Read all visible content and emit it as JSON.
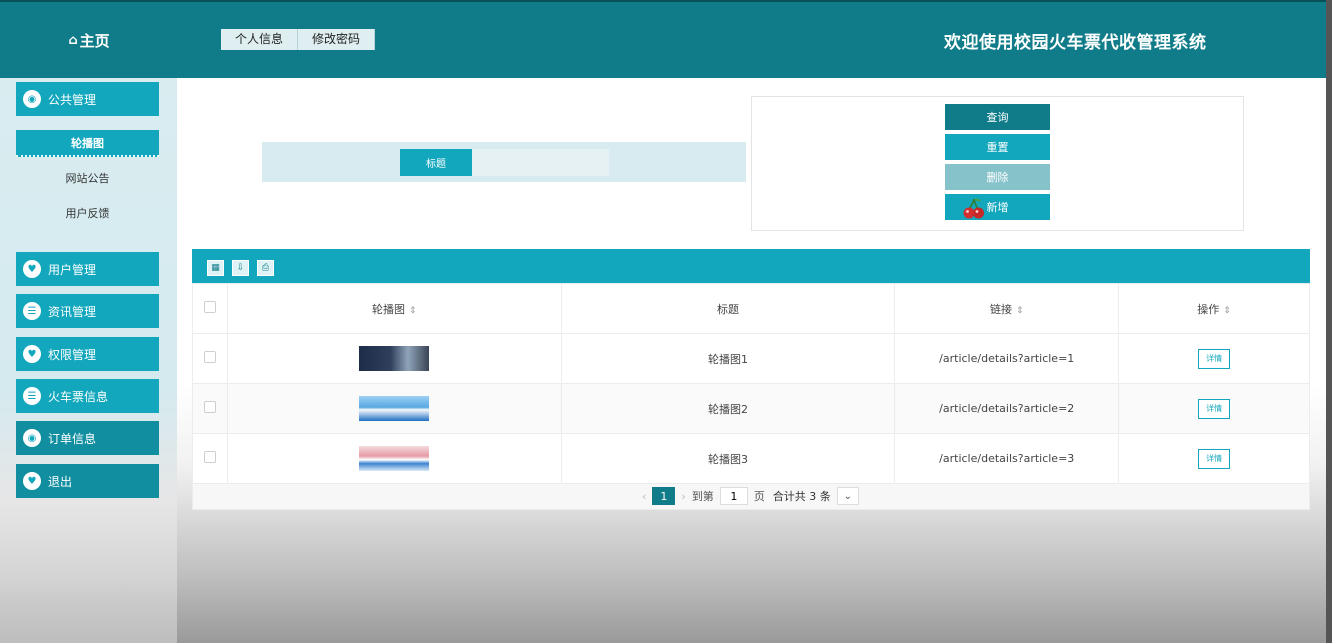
{
  "header": {
    "home_label": "主页",
    "home_icon": "home-icon",
    "tabs": [
      {
        "label": "个人信息"
      },
      {
        "label": "修改密码"
      }
    ],
    "title": "欢迎使用校园火车票代收管理系统"
  },
  "sidebar": {
    "menus": [
      {
        "label": "公共管理",
        "icon": "chat-icon"
      },
      {
        "label": "用户管理",
        "icon": "heart-icon"
      },
      {
        "label": "资讯管理",
        "icon": "list-icon"
      },
      {
        "label": "权限管理",
        "icon": "heart-icon"
      },
      {
        "label": "火车票信息",
        "icon": "list-icon"
      },
      {
        "label": "订单信息",
        "icon": "chat-icon"
      },
      {
        "label": "退出",
        "icon": "heart-icon"
      }
    ],
    "sub_items": [
      {
        "label": "轮播图",
        "active": true
      },
      {
        "label": "网站公告",
        "active": false
      },
      {
        "label": "用户反馈",
        "active": false
      }
    ]
  },
  "search": {
    "label": "标题",
    "value": "",
    "placeholder": ""
  },
  "buttons": {
    "query": "查询",
    "reset": "重置",
    "delete": "删除",
    "add": "新增"
  },
  "table": {
    "toolbar_icons": [
      "grid-icon",
      "export-icon",
      "print-icon"
    ],
    "columns": [
      "轮播图",
      "标题",
      "链接",
      "操作"
    ],
    "rows": [
      {
        "image": "banner-1",
        "title": "轮播图1",
        "link": "/article/details?article=1",
        "action": "详情"
      },
      {
        "image": "banner-2",
        "title": "轮播图2",
        "link": "/article/details?article=2",
        "action": "详情"
      },
      {
        "image": "banner-3",
        "title": "轮播图3",
        "link": "/article/details?article=3",
        "action": "详情"
      }
    ]
  },
  "pagination": {
    "current_page": "1",
    "goto_prefix": "到第",
    "goto_value": "1",
    "goto_suffix": "页",
    "total_text": "合计共 3 条"
  },
  "colors": {
    "primary": "#12a7bc",
    "dark": "#117c89",
    "disabled": "#86c2c9"
  }
}
